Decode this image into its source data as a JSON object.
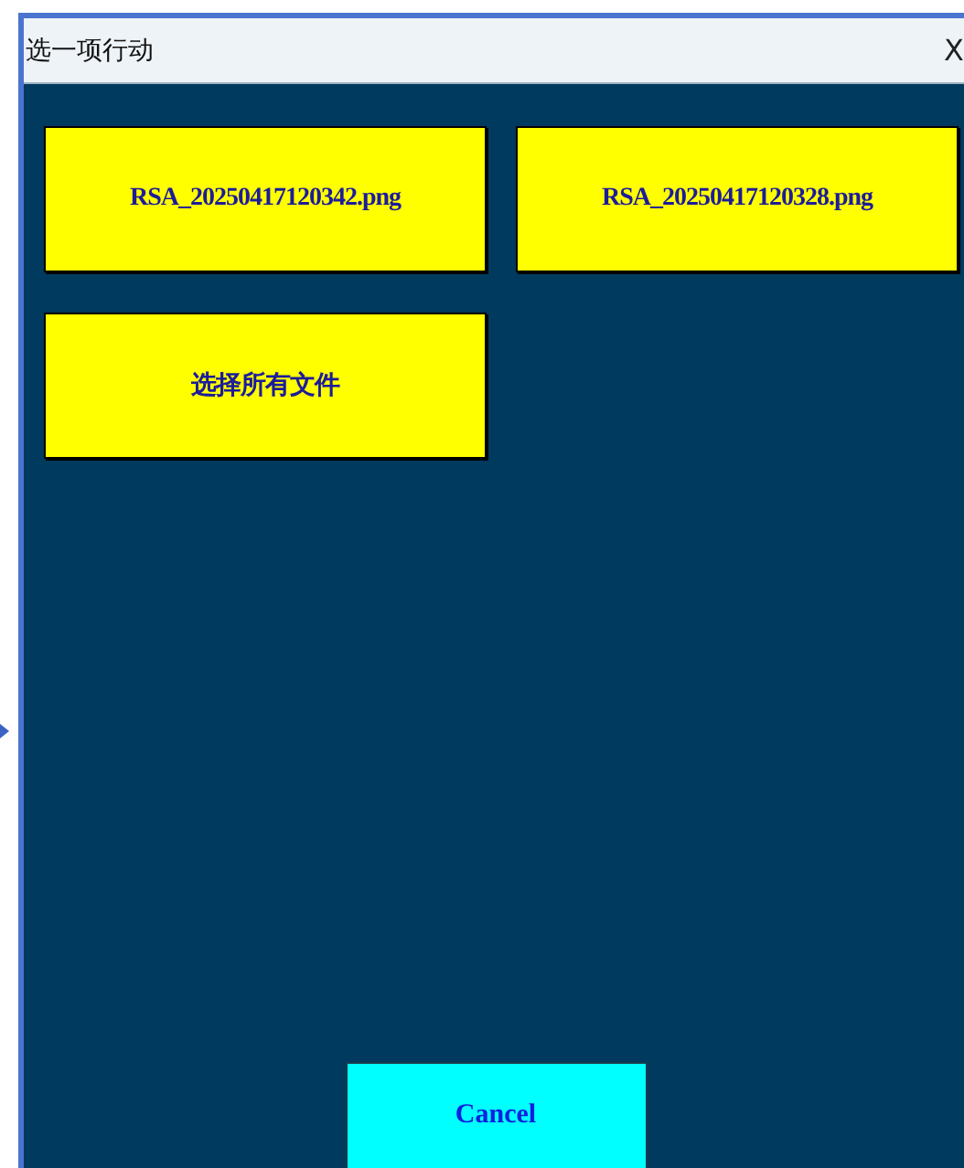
{
  "window": {
    "title": "选一项行动",
    "close": "X"
  },
  "actions": [
    {
      "label": "RSA_20250417120342.png"
    },
    {
      "label": "RSA_20250417120328.png"
    },
    {
      "label": "选择所有文件"
    }
  ],
  "cancel": "Cancel"
}
